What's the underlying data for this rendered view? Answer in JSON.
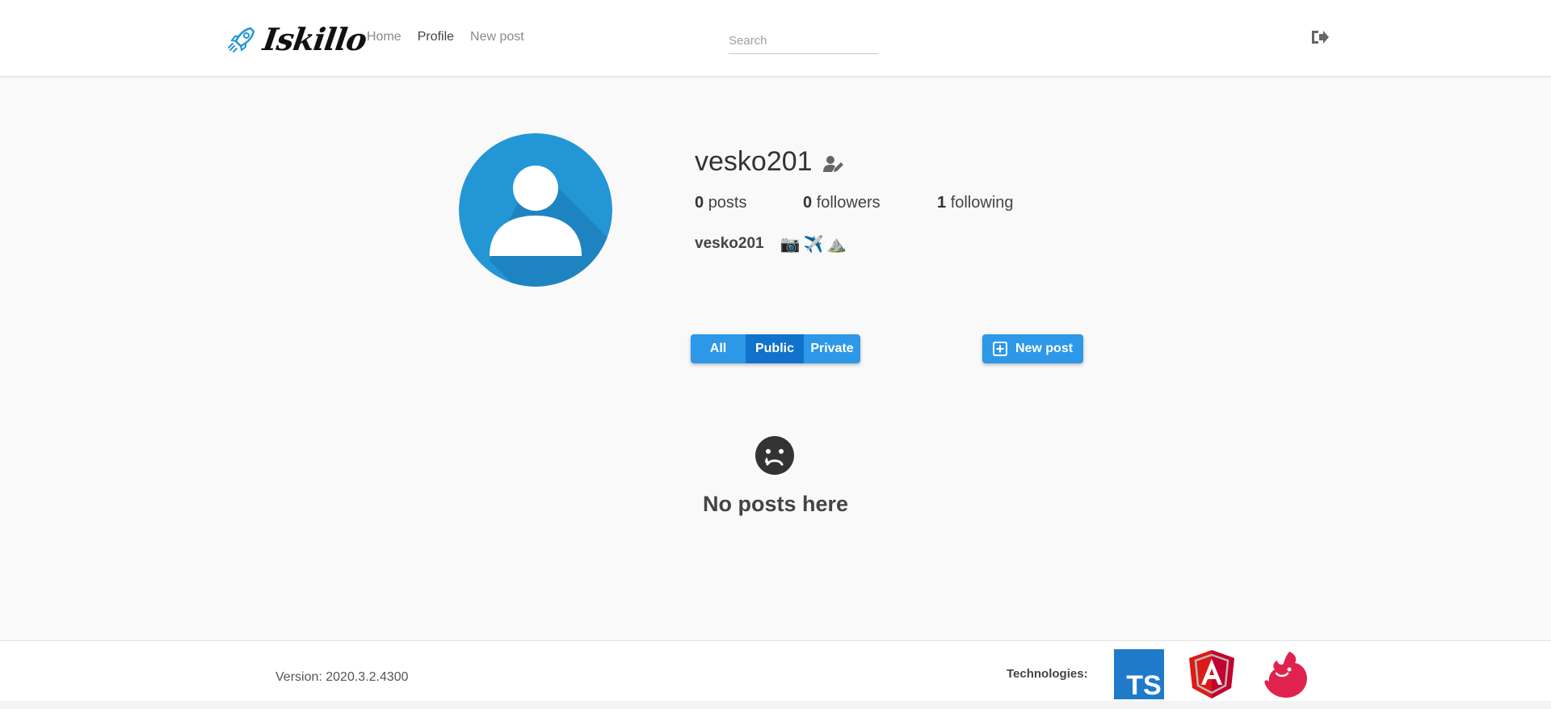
{
  "header": {
    "logo_text": "Iskillo",
    "nav": [
      {
        "label": "Home"
      },
      {
        "label": "Profile"
      },
      {
        "label": "New post"
      }
    ],
    "search": {
      "placeholder": "Search",
      "value": ""
    },
    "logout_icon": "sign-out-icon"
  },
  "profile": {
    "username": "vesko201",
    "stats": {
      "posts_count": "0",
      "posts_label": "posts",
      "followers_count": "0",
      "followers_label": "followers",
      "following_count": "1",
      "following_label": "following"
    },
    "bio_name": "vesko201",
    "bio_emojis": [
      "📷",
      "✈️",
      "⛰️"
    ]
  },
  "filters": {
    "all": "All",
    "public": "Public",
    "private": "Private",
    "selected": "Public"
  },
  "new_post_button": "New post",
  "empty_state": {
    "icon": "sad-face-icon",
    "text": "No posts here"
  },
  "footer": {
    "version": "Version: 2020.3.2.4300",
    "technologies_label": "Technologies:",
    "tech_logos": [
      "typescript-logo",
      "angular-logo",
      "nestjs-logo"
    ]
  },
  "colors": {
    "accent": "#2d98e8",
    "accent_dark": "#1172cc",
    "avatar_bg": "#2396d6"
  }
}
